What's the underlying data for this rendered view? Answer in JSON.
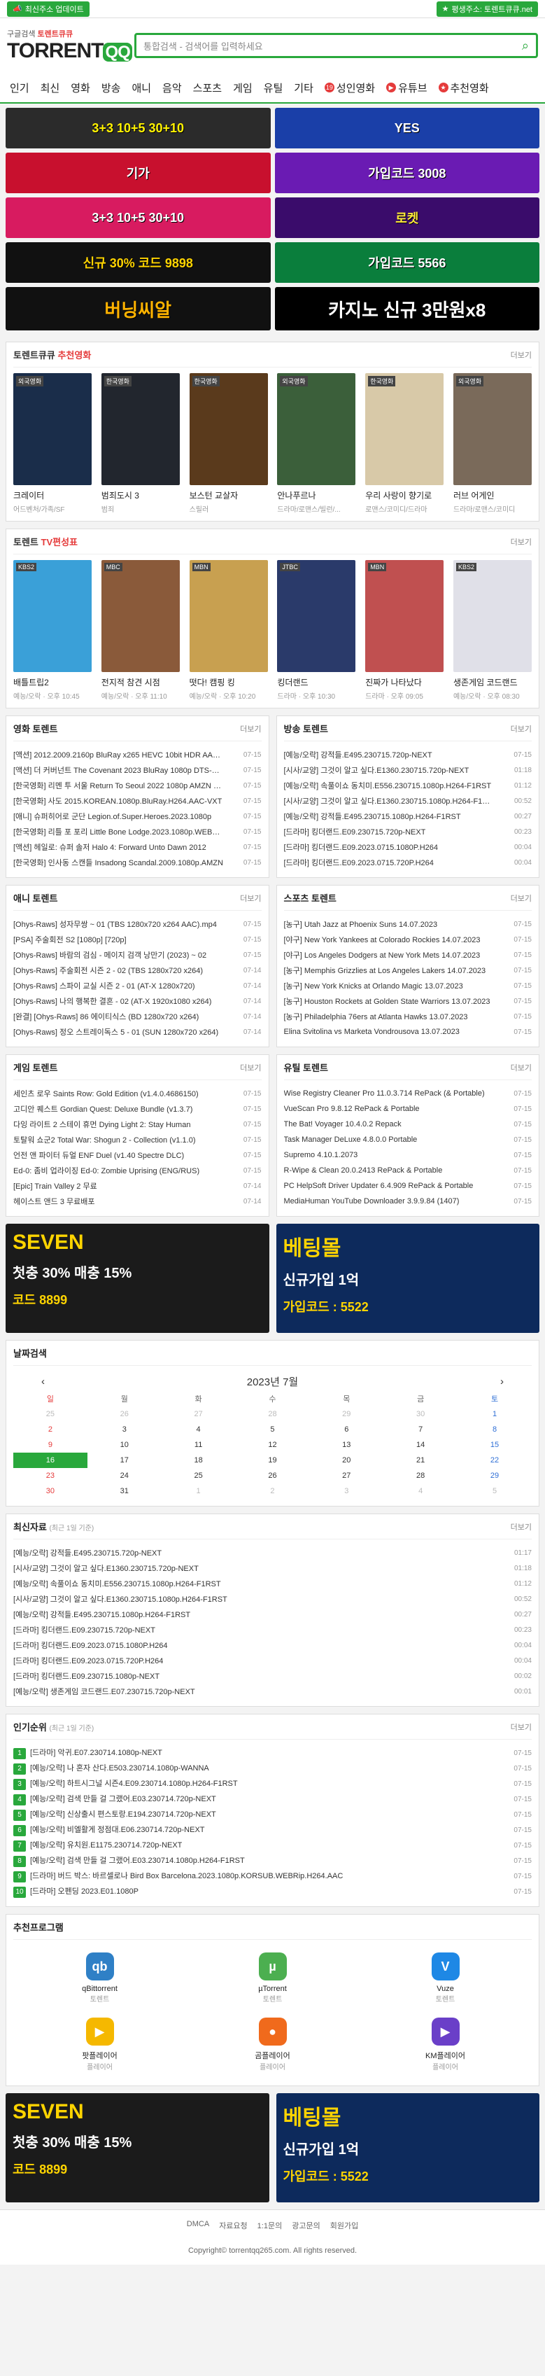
{
  "topbar": {
    "left": "최신주소 업데이트",
    "right": "평생주소: 토렌트큐큐.net"
  },
  "logo": {
    "tagline_pre": "구글검색",
    "tagline": "토렌트큐큐",
    "name": "TORRENT",
    "badge": "QQ"
  },
  "search": {
    "placeholder": "통합검색 - 검색어를 입력하세요"
  },
  "nav": [
    "인기",
    "최신",
    "영화",
    "방송",
    "애니",
    "음악",
    "스포츠",
    "게임",
    "유틸",
    "기타",
    "성인영화",
    "유튜브",
    "추천영화"
  ],
  "banners": [
    {
      "text": "3+3 10+5 30+10",
      "bg": "#2b2b2b",
      "fg": "#fff200"
    },
    {
      "text": "YES",
      "bg": "#1a3fa8",
      "fg": "#ffffff"
    },
    {
      "text": "기가",
      "bg": "#c8102e",
      "fg": "#ffffff"
    },
    {
      "text": "가입코드 3008",
      "bg": "#6a1bb3",
      "fg": "#ffffff"
    },
    {
      "text": "3+3 10+5 30+10",
      "bg": "#d81b60",
      "fg": "#ffffff"
    },
    {
      "text": "로켓",
      "bg": "#3a0c6b",
      "fg": "#ffeb3b"
    },
    {
      "text": "신규 30% 코드 9898",
      "bg": "#111111",
      "fg": "#ffd400"
    },
    {
      "text": "가입코드 5566",
      "bg": "#0a7e3c",
      "fg": "#ffffff"
    }
  ],
  "wide_banners": [
    {
      "text": "버닝씨알",
      "bg": "#111",
      "fg": "#ffb300"
    },
    {
      "text": "카지노 신규 3만원x8",
      "bg": "#000",
      "fg": "#ffffff"
    }
  ],
  "movies_box": {
    "title_pre": "토렌트큐큐",
    "title": "추천영화",
    "more": "더보기",
    "items": [
      {
        "badge": "외국영화",
        "title": "크레이터",
        "sub": "어드벤처/가족/SF",
        "bg": "#1a2d4a"
      },
      {
        "badge": "한국영화",
        "title": "범죄도시 3",
        "sub": "범죄",
        "bg": "#22262e"
      },
      {
        "badge": "한국영화",
        "title": "보스턴 교살자",
        "sub": "스릴러",
        "bg": "#5a3a1c"
      },
      {
        "badge": "외국영화",
        "title": "안나푸르나",
        "sub": "드라마/로맨스/빌런/...",
        "bg": "#3b5f3a"
      },
      {
        "badge": "한국영화",
        "title": "우리 사랑이 향기로",
        "sub": "로맨스/코미디/드라마",
        "bg": "#d8c9a8"
      },
      {
        "badge": "외국영화",
        "title": "러브 어게인",
        "sub": "드라마/로맨스/코미디",
        "bg": "#7a6a5a"
      }
    ]
  },
  "tv_box": {
    "title_pre": "토렌트",
    "title": "TV편성표",
    "more": "더보기",
    "items": [
      {
        "badge": "KBS2",
        "title": "배틀트립2",
        "sub": "예능/오락 · 오후 10:45",
        "bg": "#3aa0d8"
      },
      {
        "badge": "MBC",
        "title": "전지적 참견 시점",
        "sub": "예능/오락 · 오후 11:10",
        "bg": "#8a5a3a"
      },
      {
        "badge": "MBN",
        "title": "떳다! 캠핑 킹",
        "sub": "예능/오락 · 오후 10:20",
        "bg": "#c8a050"
      },
      {
        "badge": "JTBC",
        "title": "킹더랜드",
        "sub": "드라마 · 오후 10:30",
        "bg": "#2a3a6a"
      },
      {
        "badge": "MBN",
        "title": "진짜가 나타났다",
        "sub": "드라마 · 오후 09:05",
        "bg": "#c05050"
      },
      {
        "badge": "KBS2",
        "title": "생존게임 코드랜드",
        "sub": "예능/오락 · 오후 08:30",
        "bg": "#e0e0e8"
      }
    ]
  },
  "movie_torrent": {
    "title": "영화 토렌트",
    "more": "더보기",
    "rows": [
      [
        "[액션] 2012.2009.2160p BluRay x265 HEVC 10bit HDR AAC 5.1 Tigole",
        "07-15"
      ],
      [
        "[액션] 더 커버넌트 The Covenant 2023 BluRay 1080p DTS-HD MA",
        "07-15"
      ],
      [
        "[한국영화] 리멘 투 서울 Return To Seoul 2022 1080p AMZN WEB-DL",
        "07-15"
      ],
      [
        "[한국영화] 사도 2015.KOREAN.1080p.BluRay.H264.AAC-VXT",
        "07-15"
      ],
      [
        "[애니] 슈퍼히어로 군단 Legion.of.Super.Heroes.2023.1080p",
        "07-15"
      ],
      [
        "[한국영화] 리틀 포 포리 Little Bone Lodge.2023.1080p.WEBRip",
        "07-15"
      ],
      [
        "[액션] 헤일로: 슈퍼 솔저 Halo 4: Forward Unto Dawn 2012",
        "07-15"
      ],
      [
        "[한국영화] 인사동 스캔들 Insadong Scandal.2009.1080p.AMZN",
        "07-15"
      ]
    ]
  },
  "tv_torrent": {
    "title": "방송 토렌트",
    "more": "더보기",
    "rows": [
      [
        "[예능/오락] 강적들.E495.230715.720p-NEXT",
        "07-15"
      ],
      [
        "[시사/교양] 그것이 알고 싶다.E1360.230715.720p-NEXT",
        "01:18"
      ],
      [
        "[예능/오락] 속풀이쇼 동치미.E556.230715.1080p.H264-F1RST",
        "01:12"
      ],
      [
        "[시사/교양] 그것이 알고 싶다.E1360.230715.1080p.H264-F1RST",
        "00:52"
      ],
      [
        "[예능/오락] 강적들.E495.230715.1080p.H264-F1RST",
        "00:27"
      ],
      [
        "[드라마] 킹더랜드.E09.230715.720p-NEXT",
        "00:23"
      ],
      [
        "[드라마] 킹더랜드.E09.2023.0715.1080P.H264",
        "00:04"
      ],
      [
        "[드라마] 킹더랜드.E09.2023.0715.720P.H264",
        "00:04"
      ]
    ]
  },
  "anime_torrent": {
    "title": "애니 토렌트",
    "more": "더보기",
    "rows": [
      [
        "[Ohys-Raws] 성자무쌍 ~ 01 (TBS 1280x720 x264 AAC).mp4",
        "07-15"
      ],
      [
        "[PSA] 주술회전 S2 [1080p] [720p]",
        "07-15"
      ],
      [
        "[Ohys-Raws] 바람의 검심 - 메이지 검객 낭만기 (2023) ~ 02",
        "07-15"
      ],
      [
        "[Ohys-Raws] 주술회전 시즌 2 - 02 (TBS 1280x720 x264)",
        "07-14"
      ],
      [
        "[Ohys-Raws] 스파이 교실 시즌 2 - 01 (AT-X 1280x720)",
        "07-14"
      ],
      [
        "[Ohys-Raws] 나의 행복한 결혼 - 02 (AT-X 1920x1080 x264)",
        "07-14"
      ],
      [
        "[완결] [Ohys-Raws] 86 에이티식스 (BD 1280x720 x264)",
        "07-14"
      ],
      [
        "[Ohys-Raws] 정오 스트레이독스 5 - 01 (SUN 1280x720 x264)",
        "07-14"
      ]
    ]
  },
  "sports_torrent": {
    "title": "스포츠 토렌트",
    "more": "더보기",
    "rows": [
      [
        "[농구] Utah Jazz at Phoenix Suns 14.07.2023",
        "07-15"
      ],
      [
        "[야구] New York Yankees at Colorado Rockies 14.07.2023",
        "07-15"
      ],
      [
        "[야구] Los Angeles Dodgers at New York Mets 14.07.2023",
        "07-15"
      ],
      [
        "[농구] Memphis Grizzlies at Los Angeles Lakers 14.07.2023",
        "07-15"
      ],
      [
        "[농구] New York Knicks at Orlando Magic 13.07.2023",
        "07-15"
      ],
      [
        "[농구] Houston Rockets at Golden State Warriors 13.07.2023",
        "07-15"
      ],
      [
        "[농구] Philadelphia 76ers at Atlanta Hawks 13.07.2023",
        "07-15"
      ],
      [
        "Elina Svitolina vs Marketa Vondrousova 13.07.2023",
        "07-15"
      ]
    ]
  },
  "game_torrent": {
    "title": "게임 토렌트",
    "more": "더보기",
    "rows": [
      [
        "세인츠 로우 Saints Row: Gold Edition (v1.4.0.4686150)",
        "07-15"
      ],
      [
        "고디안 퀘스트 Gordian Quest: Deluxe Bundle (v1.3.7)",
        "07-15"
      ],
      [
        "다잉 라이트 2 스테이 휴먼 Dying Light 2: Stay Human",
        "07-15"
      ],
      [
        "토탈워 쇼군2 Total War: Shogun 2 - Collection (v1.1.0)",
        "07-15"
      ],
      [
        "언전 앤 파이터 듀얼 ENF Duel (v1.40 Spectre DLC)",
        "07-15"
      ],
      [
        "Ed-0: 좀비 업라이징 Ed-0: Zombie Uprising (ENG/RUS)",
        "07-15"
      ],
      [
        "[Epic] Train Valley 2 무료",
        "07-14"
      ],
      [
        "헤이스트 앤드 3 무료배포",
        "07-14"
      ]
    ]
  },
  "util_torrent": {
    "title": "유틸 토렌트",
    "more": "더보기",
    "rows": [
      [
        "Wise Registry Cleaner Pro 11.0.3.714 RePack (& Portable)",
        "07-15"
      ],
      [
        "VueScan Pro 9.8.12 RePack & Portable",
        "07-15"
      ],
      [
        "The Bat! Voyager 10.4.0.2 Repack",
        "07-15"
      ],
      [
        "Task Manager DeLuxe 4.8.0.0 Portable",
        "07-15"
      ],
      [
        "Supremo 4.10.1.2073",
        "07-15"
      ],
      [
        "R-Wipe & Clean 20.0.2413 RePack & Portable",
        "07-15"
      ],
      [
        "PC HelpSoft Driver Updater 6.4.909 RePack & Portable",
        "07-15"
      ],
      [
        "MediaHuman YouTube Downloader 3.9.9.84 (1407)",
        "07-15"
      ]
    ]
  },
  "midads": [
    {
      "text1": "SEVEN",
      "text2": "첫충 30% 매충 15%",
      "text3": "코드 8899",
      "bg": "#1b1b1b",
      "fg": "#ffd400"
    },
    {
      "text1": "베팅몰",
      "text2": "신규가입 1억",
      "text3": "가입코드 : 5522",
      "bg": "#0d2a5c",
      "fg": "#ffd400"
    }
  ],
  "calendar": {
    "title": "날짜검색",
    "month": "2023년 7월",
    "prev": "‹",
    "next": "›",
    "days": [
      "일",
      "월",
      "화",
      "수",
      "목",
      "금",
      "토"
    ],
    "weeks": [
      [
        "25",
        "26",
        "27",
        "28",
        "29",
        "30",
        "1"
      ],
      [
        "2",
        "3",
        "4",
        "5",
        "6",
        "7",
        "8"
      ],
      [
        "9",
        "10",
        "11",
        "12",
        "13",
        "14",
        "15"
      ],
      [
        "16",
        "17",
        "18",
        "19",
        "20",
        "21",
        "22"
      ],
      [
        "23",
        "24",
        "25",
        "26",
        "27",
        "28",
        "29"
      ],
      [
        "30",
        "31",
        "1",
        "2",
        "3",
        "4",
        "5"
      ]
    ],
    "today": "16"
  },
  "latest": {
    "title": "최신자료",
    "sub": "(최근 1일 기준)",
    "more": "더보기",
    "rows": [
      [
        "[예능/오락] 강적들.E495.230715.720p-NEXT",
        "01:17"
      ],
      [
        "[시사/교양] 그것이 알고 싶다.E1360.230715.720p-NEXT",
        "01:18"
      ],
      [
        "[예능/오락] 속풀이쇼 동치미.E556.230715.1080p.H264-F1RST",
        "01:12"
      ],
      [
        "[시사/교양] 그것이 알고 싶다.E1360.230715.1080p.H264-F1RST",
        "00:52"
      ],
      [
        "[예능/오락] 강적들.E495.230715.1080p.H264-F1RST",
        "00:27"
      ],
      [
        "[드라마] 킹더랜드.E09.230715.720p-NEXT",
        "00:23"
      ],
      [
        "[드라마] 킹더랜드.E09.2023.0715.1080P.H264",
        "00:04"
      ],
      [
        "[드라마] 킹더랜드.E09.2023.0715.720P.H264",
        "00:04"
      ],
      [
        "[드라마] 킹더랜드.E09.230715.1080p-NEXT",
        "00:02"
      ],
      [
        "[예능/오락] 생존게임 코드랜드.E07.230715.720p-NEXT",
        "00:01"
      ]
    ]
  },
  "popular": {
    "title": "인기순위",
    "sub": "(최근 1일 기준)",
    "more": "더보기",
    "rows": [
      [
        "[드라마] 악귀.E07.230714.1080p-NEXT",
        "07-15"
      ],
      [
        "[예능/오락] 나 혼자 산다.E503.230714.1080p-WANNA",
        "07-15"
      ],
      [
        "[예능/오락] 하트시그널 시즌4.E09.230714.1080p.H264-F1RST",
        "07-15"
      ],
      [
        "[예능/오락] 검색 만들 걸 그랬어.E03.230714.720p-NEXT",
        "07-15"
      ],
      [
        "[예능/오락] 신상출시 편스토랑.E194.230714.720p-NEXT",
        "07-15"
      ],
      [
        "[예능/오락] 비엘활게 정점대.E06.230714.720p-NEXT",
        "07-15"
      ],
      [
        "[예능/오락] 유치원.E1175.230714.720p-NEXT",
        "07-15"
      ],
      [
        "[예능/오락] 검색 만들 걸 그랬어.E03.230714.1080p.H264-F1RST",
        "07-15"
      ],
      [
        "[드라마] 버드 박스: 바르셀로나 Bird Box Barcelona.2023.1080p.KORSUB.WEBRip.H264.AAC",
        "07-15"
      ],
      [
        "[드라마] 오펜딩 2023.E01.1080P",
        "07-15"
      ]
    ]
  },
  "apps": {
    "title": "추천프로그램",
    "items": [
      {
        "name": "qBittorrent",
        "sub": "토렌트",
        "letter": "qb",
        "bg": "#2f80c6"
      },
      {
        "name": "µTorrent",
        "sub": "토렌트",
        "letter": "µ",
        "bg": "#4caf50"
      },
      {
        "name": "Vuze",
        "sub": "토렌트",
        "letter": "V",
        "bg": "#1e88e5"
      },
      {
        "name": "팟플레이어",
        "sub": "플레이어",
        "letter": "▶",
        "bg": "#f5b800"
      },
      {
        "name": "곰플레이어",
        "sub": "플레이어",
        "letter": "●",
        "bg": "#f06a1c"
      },
      {
        "name": "KM플레이어",
        "sub": "플레이어",
        "letter": "▶",
        "bg": "#6a3fc8"
      }
    ]
  },
  "footer": {
    "links": [
      "DMCA",
      "자료요청",
      "1:1문의",
      "광고문의",
      "회원가입"
    ],
    "copyright": "Copyright© torrentqq265.com. All rights reserved."
  }
}
